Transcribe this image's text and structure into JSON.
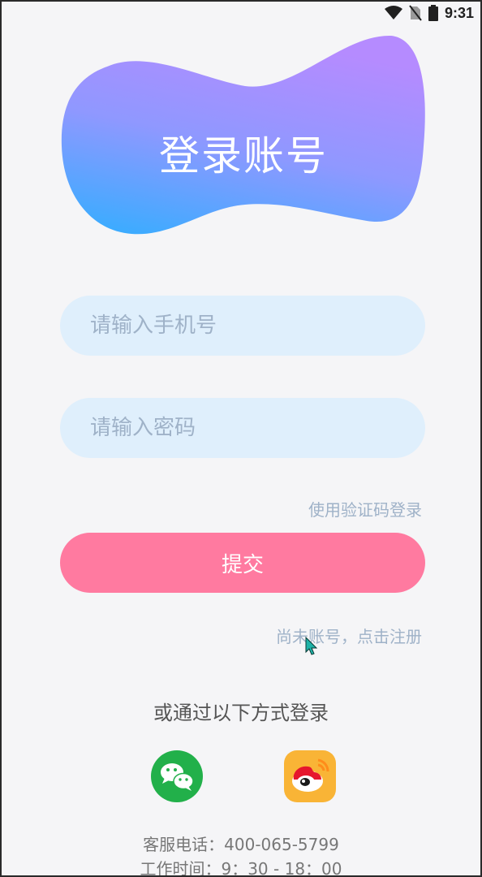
{
  "status_bar": {
    "time": "9:31",
    "icons": [
      "wifi-icon",
      "no-sim-icon",
      "battery-icon"
    ]
  },
  "header": {
    "title": "登录账号",
    "gradient_colors": [
      "#b58bff",
      "#3aacff"
    ]
  },
  "form": {
    "phone_placeholder": "请输入手机号",
    "password_placeholder": "请输入密码",
    "sms_login_link": "使用验证码登录",
    "submit_label": "提交",
    "register_link": "尚未账号，点击注册"
  },
  "alt_login": {
    "title": "或通过以下方式登录",
    "providers": [
      "wechat-icon",
      "weibo-icon"
    ]
  },
  "footer": {
    "phone": "客服电话：400-065-5799",
    "hours": "工作时间：9：30 - 18：00"
  },
  "colors": {
    "accent_pink": "#ff7aa0",
    "input_bg": "#dfeffc",
    "link_gray": "#9fb2c8",
    "wechat_green": "#22b04a",
    "weibo_orange": "#f9b436"
  }
}
